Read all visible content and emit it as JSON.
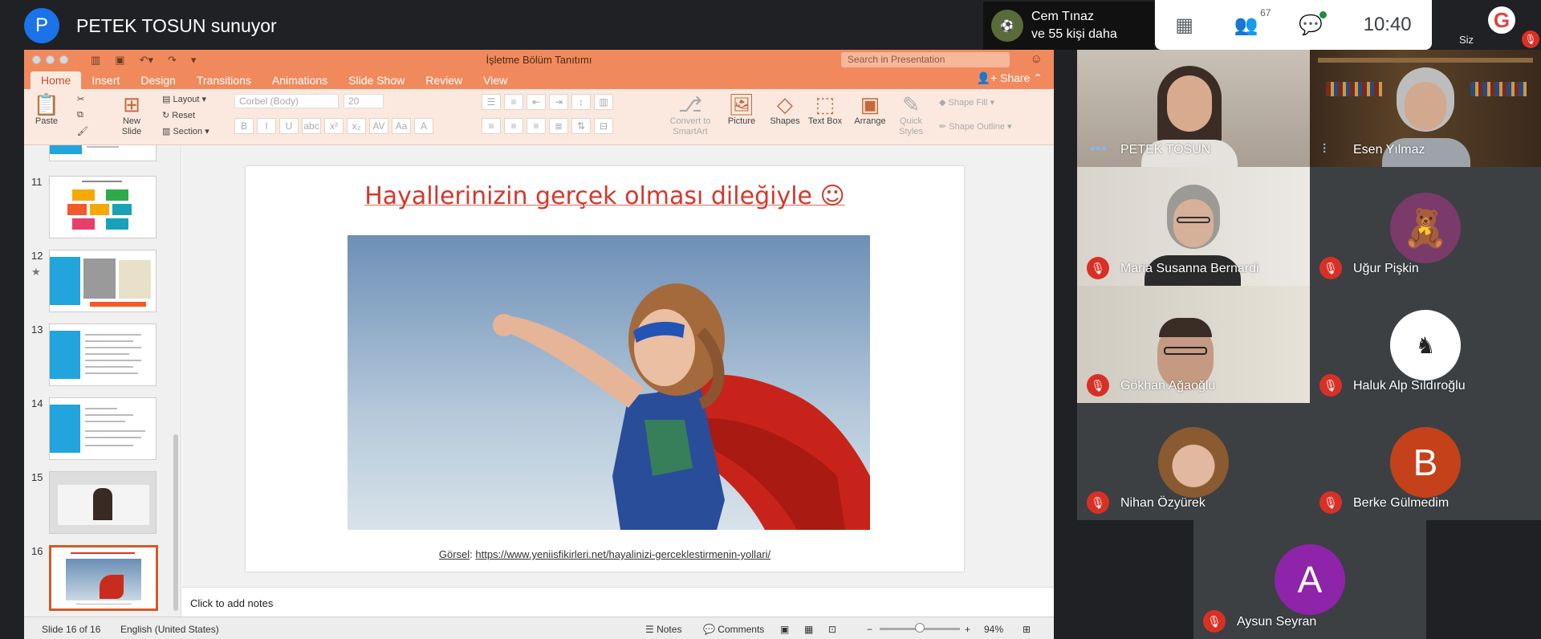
{
  "meeting": {
    "presenter_initial": "P",
    "presenting_text": "PETEK TOSUN sunuyor",
    "pinned_name": "Cem Tınaz",
    "pinned_more": "ve 55 kişi daha",
    "people_count": "67",
    "clock": "10:40",
    "self_label": "Siz",
    "self_logo": "G"
  },
  "ppt": {
    "doc_title": "İşletme Bölüm Tanıtımı",
    "search_placeholder": "Search in Presentation",
    "share_label": "Share",
    "tabs": [
      "Home",
      "Insert",
      "Design",
      "Transitions",
      "Animations",
      "Slide Show",
      "Review",
      "View"
    ],
    "ribbon": {
      "paste": "Paste",
      "new_slide": "New Slide",
      "layout": "Layout",
      "reset": "Reset",
      "section": "Section",
      "font": "Corbel (Body)",
      "font_size": "20",
      "convert": "Convert to SmartArt",
      "picture": "Picture",
      "shapes": "Shapes",
      "textbox": "Text Box",
      "arrange": "Arrange",
      "quick_styles": "Quick Styles",
      "shape_fill": "Shape Fill",
      "shape_outline": "Shape Outline"
    },
    "thumb_numbers": [
      "11",
      "12",
      "13",
      "14",
      "15",
      "16"
    ],
    "slide_title": "Hayallerinizin gerçek olması dileğiyle ☺",
    "caption_label": "Görsel",
    "caption_url": "https://www.yeniisfikirleri.net/hayalinizi-gerceklestirmenin-yollari/",
    "notes_placeholder": "Click to add notes",
    "status": {
      "slide_counter": "Slide 16 of 16",
      "language": "English (United States)",
      "notes": "Notes",
      "comments": "Comments",
      "zoom": "94%"
    }
  },
  "participants": [
    {
      "name": "PETEK TOSUN",
      "state": "speaking"
    },
    {
      "name": "Esen Yılmaz",
      "state": "speaking"
    },
    {
      "name": "Maria Susanna Bernardi",
      "state": "muted"
    },
    {
      "name": "Uğur Pişkin",
      "state": "muted"
    },
    {
      "name": "Gökhan Ağaoğlu",
      "state": "muted"
    },
    {
      "name": "Haluk Alp Sıldıroğlu",
      "state": "muted"
    },
    {
      "name": "Nihan Özyürek",
      "state": "muted"
    },
    {
      "name": "Berke Gülmedim",
      "state": "muted",
      "initial": "B",
      "color": "#c5411a"
    },
    {
      "name": "Aysun Seyran",
      "state": "muted",
      "initial": "A",
      "color": "#8e24aa"
    }
  ],
  "colors": {
    "ppt_accent": "#f08a5d",
    "meet_bg": "#202124",
    "mic_off": "#d93025"
  }
}
